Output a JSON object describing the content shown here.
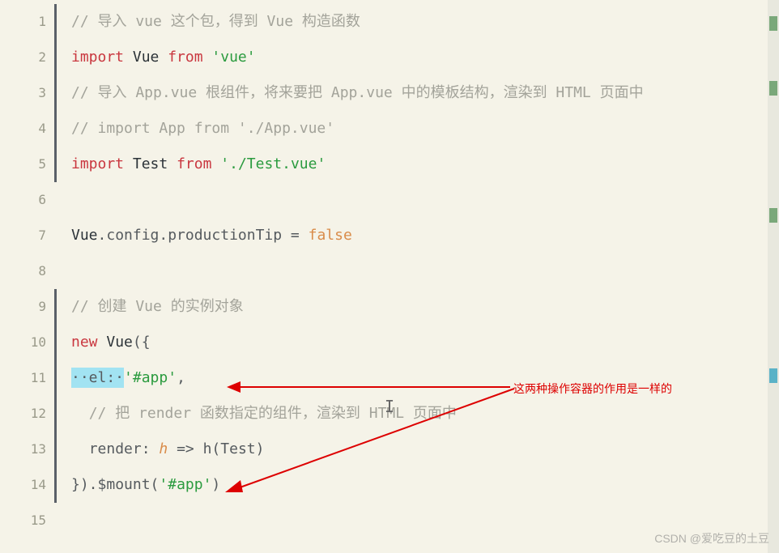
{
  "lines": {
    "l1": {
      "num": "1",
      "marked": true
    },
    "l2": {
      "num": "2",
      "marked": true
    },
    "l3": {
      "num": "3",
      "marked": true
    },
    "l4": {
      "num": "4",
      "marked": true
    },
    "l5": {
      "num": "5",
      "marked": true
    },
    "l6": {
      "num": "6",
      "marked": false
    },
    "l7": {
      "num": "7",
      "marked": false
    },
    "l8": {
      "num": "8",
      "marked": false
    },
    "l9": {
      "num": "9",
      "marked": true
    },
    "l10": {
      "num": "10",
      "marked": true
    },
    "l11": {
      "num": "11",
      "marked": true
    },
    "l12": {
      "num": "12",
      "marked": true
    },
    "l13": {
      "num": "13",
      "marked": true
    },
    "l14": {
      "num": "14",
      "marked": true
    },
    "l15": {
      "num": "15",
      "marked": false
    }
  },
  "code": {
    "c1_comment": "// 导入 vue 这个包，得到 Vue 构造函数",
    "c2_import": "import",
    "c2_vue": " Vue ",
    "c2_from": "from",
    "c2_sp": " ",
    "c2_str": "'vue'",
    "c3_comment": "// 导入 App.vue 根组件，将来要把 App.vue 中的模板结构，渲染到 HTML 页面中",
    "c4_comment": "// import App from './App.vue'",
    "c5_import": "import",
    "c5_test": " Test ",
    "c5_from": "from",
    "c5_sp": " ",
    "c5_str": "'./Test.vue'",
    "c7_vue": "Vue",
    "c7_rest": ".config.productionTip = ",
    "c7_false": "false",
    "c9_comment": "// 创建 Vue 的实例对象",
    "c10_new": "new",
    "c10_sp": " ",
    "c10_vue": "Vue",
    "c10_paren": "({",
    "c11_hl": "··el:·",
    "c11_str": "'#app'",
    "c11_comma": ",",
    "c12_indent": "  ",
    "c12_comment": "// 把 render 函数指定的组件，渲染到 HTML 页面中",
    "c13_indent": "  ",
    "c13_render": "render",
    "c13_colon": ": ",
    "c13_h": "h",
    "c13_arrow": " => h(Test)",
    "c14_close": "}).",
    "c14_mount": "$mount",
    "c14_paren_o": "(",
    "c14_str": "'#app'",
    "c14_paren_c": ")"
  },
  "annotation": {
    "text": "这两种操作容器的作用是一样的"
  },
  "watermark": {
    "text": "CSDN @爱吃豆的土豆"
  }
}
